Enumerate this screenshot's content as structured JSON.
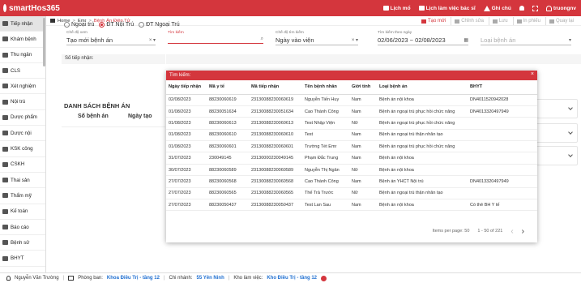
{
  "app": {
    "name": "smartHos365"
  },
  "topbar": {
    "lich_mo": "Lịch mổ",
    "lich_lam_viec": "Lịch làm việc bác sĩ",
    "ghi_chu": "Ghi chú",
    "user": "truongnv"
  },
  "sidebar": {
    "items": [
      {
        "label": "Tiếp nhận"
      },
      {
        "label": "Khám bệnh"
      },
      {
        "label": "Thu ngân"
      },
      {
        "label": "CLS"
      },
      {
        "label": "Xét nghiệm"
      },
      {
        "label": "Nội trú"
      },
      {
        "label": "Dược phẩm"
      },
      {
        "label": "Dược nội"
      },
      {
        "label": "KSK công"
      },
      {
        "label": "CSKH"
      },
      {
        "label": "Thai sản"
      },
      {
        "label": "Thẩm mỹ"
      },
      {
        "label": "Kế toán"
      },
      {
        "label": "Báo cáo"
      },
      {
        "label": "Bệnh sử"
      },
      {
        "label": "BHYT"
      }
    ]
  },
  "breadcrumb": {
    "home": "Home",
    "level1": "Emr",
    "level2": "Bệnh Án Điện Tử"
  },
  "toolbar": {
    "new": "Tạo mới",
    "edit": "Chỉnh sửa",
    "save": "Lưu",
    "print": "In phiếu",
    "back": "Quay lại"
  },
  "patient_type": {
    "options": [
      "Ngoại trú",
      "ĐT Nội Trú",
      "ĐT Ngoại Trú"
    ],
    "selected": "ĐT Nội Trú"
  },
  "form": {
    "mode_label": "Chế độ xem",
    "mode_value": "Tạo mới bệnh án",
    "search_label": "Tìm kiếm",
    "search_value": "",
    "search_mode_label": "Chế độ tìm kiếm",
    "search_mode_value": "Ngày vào viện",
    "date_label": "Tìm kiếm theo ngày",
    "date_value": "02/06/2023 ~ 02/08/2023",
    "record_type_placeholder": "Loại bệnh án",
    "receive_label": "Số tiếp nhận:"
  },
  "list": {
    "title": "DANH SÁCH BỆNH ÁN",
    "col_so": "Số bệnh án",
    "col_ngay": "Ngày tạo"
  },
  "popup": {
    "title": "Tìm kiếm:",
    "columns": [
      "Ngày tiếp nhận",
      "Mã y tế",
      "Mã tiếp nhận",
      "Tên bệnh nhân",
      "Giới tính",
      "Loại bệnh án",
      "BHYT"
    ],
    "rows": [
      [
        "02/08/2023",
        "88230060619",
        "23130088230060619",
        "Nguyễn Tiến Huy",
        "Nam",
        "Bệnh án nội khoa",
        "DN4011520942028"
      ],
      [
        "01/08/2023",
        "88230051634",
        "23130088230051634",
        "Cao Thành Công",
        "Nam",
        "Bệnh án ngoại trú phục hồi chức năng",
        "DN4013320497949"
      ],
      [
        "01/08/2023",
        "88230060613",
        "23130088230060613",
        "Test Nhập Viện",
        "Nữ",
        "Bệnh án ngoại trú phục hồi chức năng",
        ""
      ],
      [
        "01/08/2023",
        "88230060610",
        "23130088230060610",
        "Test",
        "Nam",
        "Bệnh án ngoại trú thận nhân tạo",
        ""
      ],
      [
        "01/08/2023",
        "88230060601",
        "23130088230060601",
        "Trường Tét Emr",
        "Nam",
        "Bệnh án ngoại trú phục hồi chức năng",
        ""
      ],
      [
        "31/07/2023",
        "230049145",
        "23130000230049145",
        "Phạm Đắc Trung",
        "Nam",
        "Bệnh án nội khoa",
        ""
      ],
      [
        "30/07/2023",
        "88230060589",
        "23130088230060589",
        "Nguyễn Thị Ngân",
        "Nữ",
        "Bệnh án nội khoa",
        ""
      ],
      [
        "27/07/2023",
        "88230060568",
        "23130088230060568",
        "Cao Thành Công",
        "Nam",
        "Bệnh án YHCT Nội trú",
        "DN4013320497949"
      ],
      [
        "27/07/2023",
        "88230060565",
        "23130088230060565",
        "Thế Trả Trước",
        "Nữ",
        "Bệnh án ngoại trú thận nhân tạo",
        ""
      ],
      [
        "27/07/2023",
        "88230050437",
        "23130088230050437",
        "Test Lan Sau",
        "Nam",
        "Bệnh án nội khoa",
        "Có thẻ BH Y tế"
      ]
    ],
    "pager": {
      "per_page": "Items per page: 50",
      "range": "1 - 50 of 221"
    }
  },
  "footer": {
    "user": "Nguyễn Văn Trường",
    "room_label": "Phòng ban:",
    "room": "Khoa Điều Trị - tầng 12",
    "branch_label": "Chi nhánh:",
    "branch": "55 Yên Ninh",
    "workspace_label": "Kho làm việc:",
    "workspace": "Kho Điều Trị - tầng 12"
  },
  "colors": {
    "brand": "#d4363d",
    "link": "#1f6fd1"
  },
  "icons": [
    "logo-icon",
    "calendar-icon",
    "warning-icon",
    "bell-icon",
    "expand-icon",
    "user-icon",
    "home-icon",
    "search-icon",
    "clear-icon",
    "dropdown-icon",
    "close-icon",
    "chevron-left-icon",
    "chevron-right-icon"
  ]
}
